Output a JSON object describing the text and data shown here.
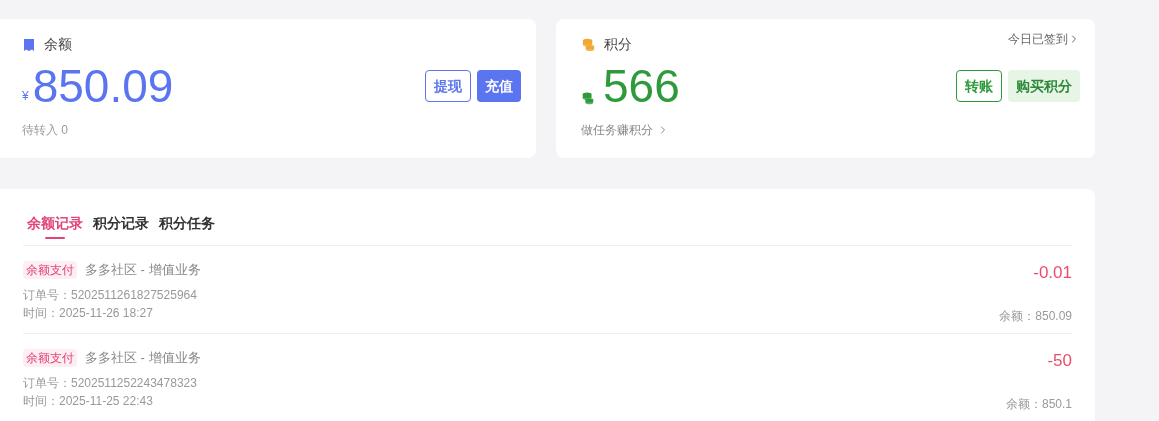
{
  "balance_card": {
    "title": "余额",
    "currency": "¥",
    "amount": "850.09",
    "pending": "待转入 0",
    "buttons": [
      {
        "label": "提现",
        "kind": "outline"
      },
      {
        "label": "充值",
        "kind": "solid"
      }
    ]
  },
  "points_card": {
    "title": "积分",
    "checkin": "今日已签到",
    "amount": "566",
    "tasks_link": "做任务赚积分",
    "buttons": [
      {
        "label": "转账",
        "kind": "outline"
      },
      {
        "label": "购买积分",
        "kind": "soft"
      }
    ]
  },
  "tabs": [
    {
      "label": "余额记录",
      "selected": true
    },
    {
      "label": "积分记录",
      "selected": false
    },
    {
      "label": "积分任务",
      "selected": false
    }
  ],
  "records": [
    {
      "tag": "余额支付",
      "title": "多多社区 - 增值业务",
      "order": "订单号：5202511261827525964",
      "time": "时间：2025-11-26 18:27",
      "change": "-0.01",
      "balance": "余额：850.09"
    },
    {
      "tag": "余额支付",
      "title": "多多社区 - 增值业务",
      "order": "订单号：5202511252243478323",
      "time": "时间：2025-11-25 22:43",
      "change": "-50",
      "balance": "余额：850.1"
    }
  ]
}
